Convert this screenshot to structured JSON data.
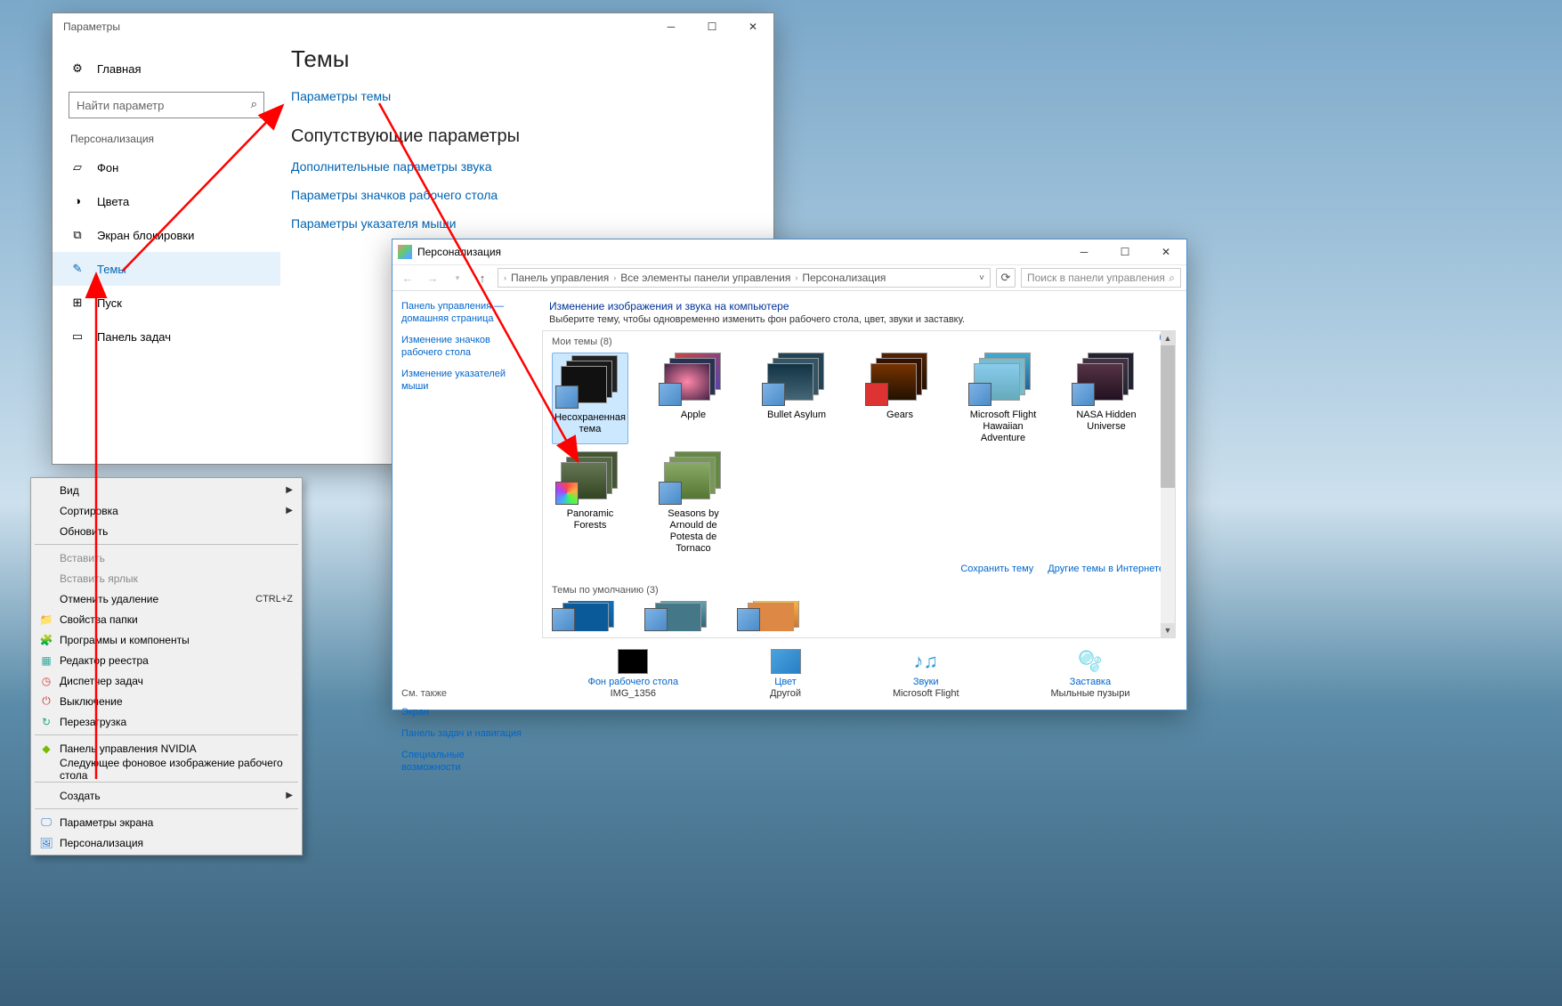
{
  "wallpaper": "beach-clouds",
  "settings": {
    "title": "Параметры",
    "home": "Главная",
    "search_placeholder": "Найти параметр",
    "category": "Персонализация",
    "items": [
      {
        "icon": "picture",
        "label": "Фон"
      },
      {
        "icon": "palette",
        "label": "Цвета"
      },
      {
        "icon": "lock",
        "label": "Экран блокировки"
      },
      {
        "icon": "brush",
        "label": "Темы",
        "active": true
      },
      {
        "icon": "start",
        "label": "Пуск"
      },
      {
        "icon": "taskbar",
        "label": "Панель задач"
      }
    ],
    "page_title": "Темы",
    "theme_params_link": "Параметры темы",
    "related_title": "Сопутствующие параметры",
    "related_links": [
      "Дополнительные параметры звука",
      "Параметры значков рабочего стола",
      "Параметры указателя мыши"
    ]
  },
  "context_menu": {
    "items": [
      {
        "label": "Вид",
        "arrow": true
      },
      {
        "label": "Сортировка",
        "arrow": true
      },
      {
        "label": "Обновить"
      },
      {
        "sep": true
      },
      {
        "label": "Вставить",
        "disabled": true
      },
      {
        "label": "Вставить ярлык",
        "disabled": true
      },
      {
        "label": "Отменить удаление",
        "shortcut": "CTRL+Z"
      },
      {
        "icon": "folder-props",
        "label": "Свойства папки"
      },
      {
        "icon": "programs",
        "label": "Программы и компоненты"
      },
      {
        "icon": "regedit",
        "label": "Редактор реестра"
      },
      {
        "icon": "taskmgr",
        "label": "Диспетчер задач"
      },
      {
        "icon": "shutdown",
        "label": "Выключение"
      },
      {
        "icon": "restart",
        "label": "Перезагрузка"
      },
      {
        "sep": true
      },
      {
        "icon": "nvidia",
        "label": "Панель управления NVIDIA"
      },
      {
        "label": "Следующее фоновое изображение рабочего стола"
      },
      {
        "sep": true
      },
      {
        "label": "Создать",
        "arrow": true
      },
      {
        "sep": true
      },
      {
        "icon": "display",
        "label": "Параметры экрана"
      },
      {
        "icon": "personalize",
        "label": "Персонализация"
      }
    ]
  },
  "cp": {
    "title": "Персонализация",
    "breadcrumbs": [
      "Панель управления",
      "Все элементы панели управления",
      "Персонализация"
    ],
    "search_placeholder": "Поиск в панели управления",
    "side_links": [
      "Панель управления — домашняя страница",
      "Изменение значков рабочего стола",
      "Изменение указателей мыши"
    ],
    "see_also_title": "См. также",
    "see_also": [
      "Экран",
      "Панель задач и навигация",
      "Специальные возможности"
    ],
    "main_title": "Изменение изображения и звука на компьютере",
    "main_desc": "Выберите тему, чтобы одновременно изменить фон рабочего стола, цвет, звуки и заставку.",
    "my_themes_label": "Мои темы (8)",
    "themes": [
      {
        "name": "Несохраненная тема",
        "selected": true,
        "style": "dark"
      },
      {
        "name": "Apple",
        "style": "apple"
      },
      {
        "name": "Bullet Asylum",
        "style": "bullet"
      },
      {
        "name": "Gears",
        "style": "gears"
      },
      {
        "name": "Microsoft Flight Hawaiian Adventure",
        "style": "flight"
      },
      {
        "name": "NASA Hidden Universe",
        "style": "nasa"
      },
      {
        "name": "Panoramic Forests",
        "style": "forest"
      },
      {
        "name": "Seasons by Arnould de Potesta de Tornaco",
        "style": "seasons"
      }
    ],
    "default_themes_label": "Темы по умолчанию (3)",
    "save_theme_link": "Сохранить тему",
    "more_themes_link": "Другие темы в Интернете",
    "bottom": [
      {
        "link": "Фон рабочего стола",
        "sub": "IMG_1356"
      },
      {
        "link": "Цвет",
        "sub": "Другой"
      },
      {
        "link": "Звуки",
        "sub": "Microsoft Flight"
      },
      {
        "link": "Заставка",
        "sub": "Мыльные пузыри"
      }
    ]
  }
}
